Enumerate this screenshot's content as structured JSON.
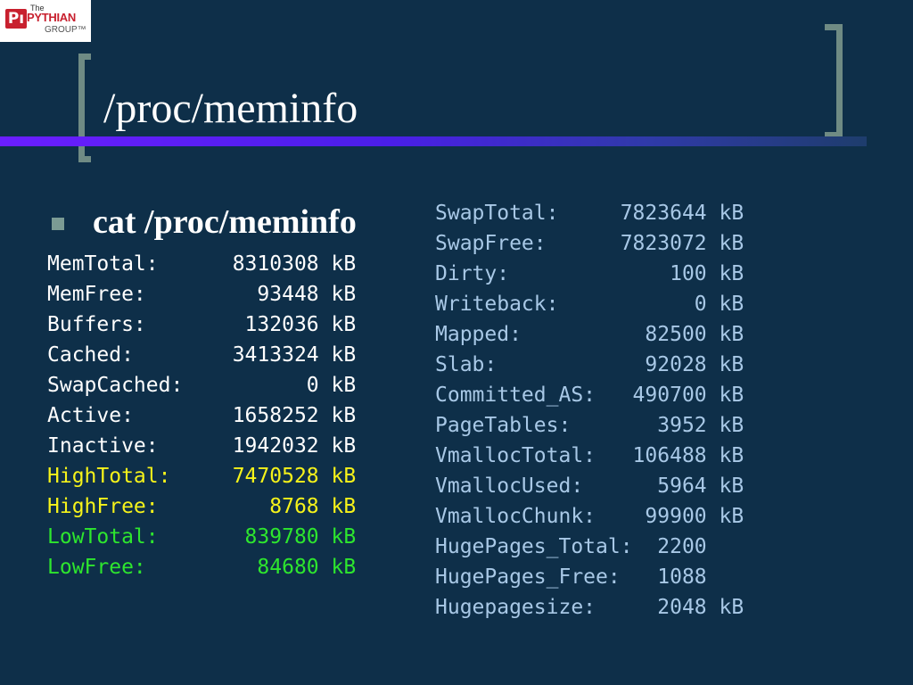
{
  "logo": {
    "the": "The",
    "name": "PYTHIAN",
    "group": "GROUP™",
    "mark": "Pı"
  },
  "title": "/proc/meminfo",
  "bullet_text": "cat /proc/meminfo",
  "colors": {
    "background": "#0e2f49",
    "default": "#ffffff",
    "high": "#f6f31a",
    "low": "#2ee62e",
    "right_column": "#a8c8e6",
    "bracket": "#6f8b84"
  },
  "left_lines": [
    {
      "text": "MemTotal:      8310308 kB",
      "color": "white"
    },
    {
      "text": "MemFree:         93448 kB",
      "color": "white"
    },
    {
      "text": "Buffers:        132036 kB",
      "color": "white"
    },
    {
      "text": "Cached:        3413324 kB",
      "color": "white"
    },
    {
      "text": "SwapCached:          0 kB",
      "color": "white"
    },
    {
      "text": "Active:        1658252 kB",
      "color": "white"
    },
    {
      "text": "Inactive:      1942032 kB",
      "color": "white"
    },
    {
      "text": "HighTotal:     7470528 kB",
      "color": "yellow"
    },
    {
      "text": "HighFree:         8768 kB",
      "color": "yellow"
    },
    {
      "text": "LowTotal:       839780 kB",
      "color": "green"
    },
    {
      "text": "LowFree:         84680 kB",
      "color": "green"
    }
  ],
  "right_lines": [
    {
      "text": "SwapTotal:     7823644 kB"
    },
    {
      "text": "SwapFree:      7823072 kB"
    },
    {
      "text": "Dirty:             100 kB"
    },
    {
      "text": "Writeback:           0 kB"
    },
    {
      "text": "Mapped:          82500 kB"
    },
    {
      "text": "Slab:            92028 kB"
    },
    {
      "text": "Committed_AS:   490700 kB"
    },
    {
      "text": "PageTables:       3952 kB"
    },
    {
      "text": "VmallocTotal:   106488 kB"
    },
    {
      "text": "VmallocUsed:      5964 kB"
    },
    {
      "text": "VmallocChunk:    99900 kB"
    },
    {
      "text": "HugePages_Total:  2200"
    },
    {
      "text": "HugePages_Free:   1088"
    },
    {
      "text": "Hugepagesize:     2048 kB"
    }
  ]
}
